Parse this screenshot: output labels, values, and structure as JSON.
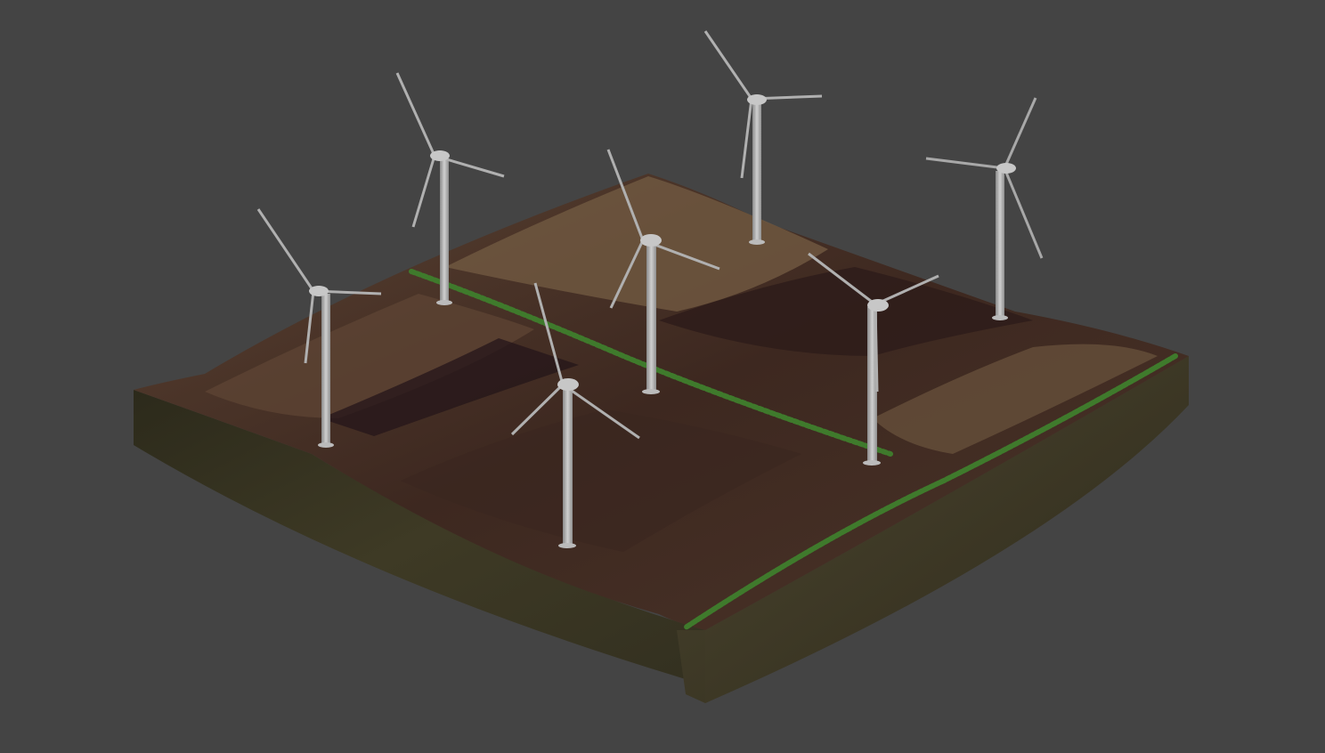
{
  "scene": {
    "background_color": "#444444",
    "subject": "wind-farm-terrain-tile",
    "turbine_count": 7,
    "colors": {
      "soil_dark": "#2e1c19",
      "soil_mid": "#4a3428",
      "soil_light": "#6e573f",
      "side_wall": "#3e3a25",
      "side_wall_dark": "#262317",
      "hedge": "#3f7a2c",
      "turbine": "#b4b4b4",
      "turbine_shade": "#8d8d8d"
    }
  }
}
